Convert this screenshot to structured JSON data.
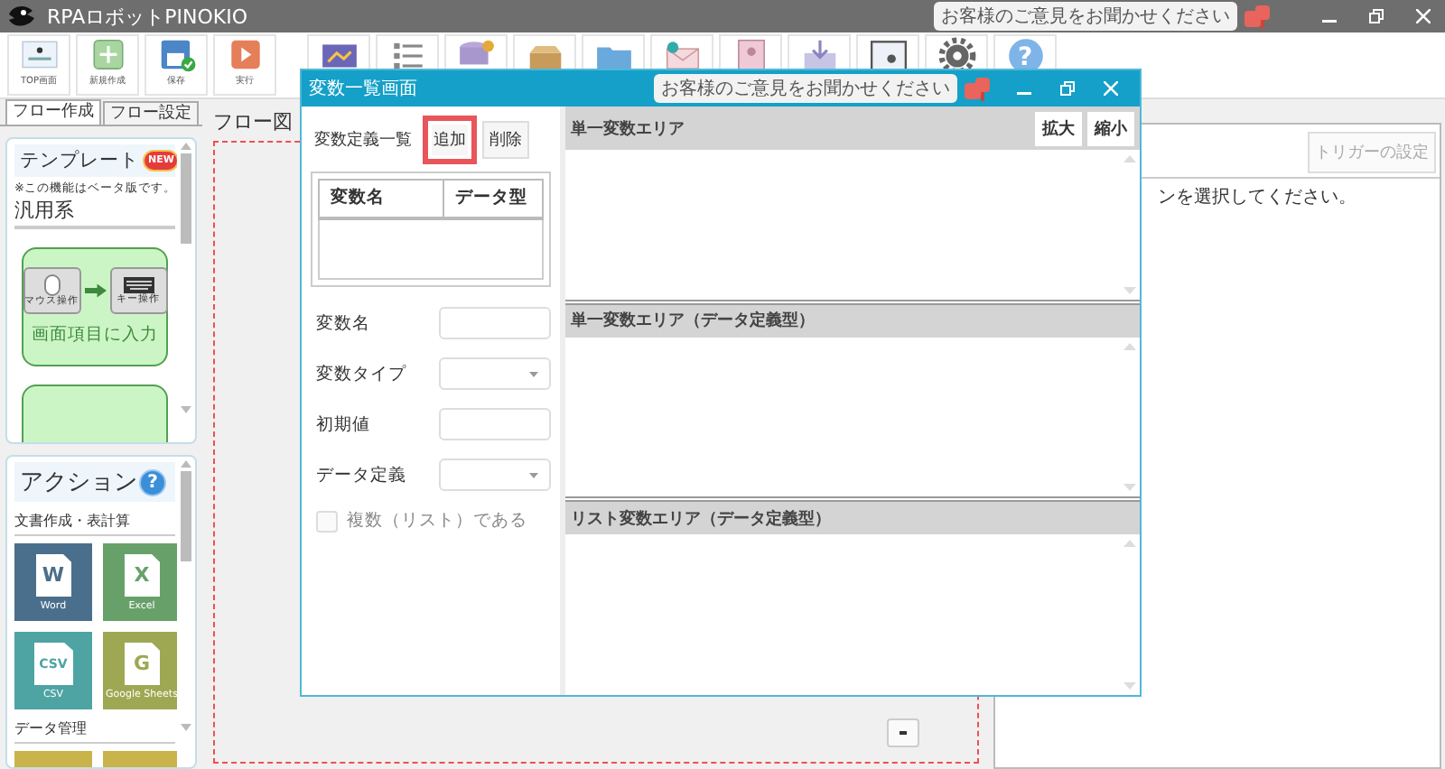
{
  "app": {
    "title": "RPAロボットPINOKIO",
    "feedback": "お客様のご意見をお聞かせください"
  },
  "toolbar": [
    {
      "label": "TOP画面",
      "kind": "top"
    },
    {
      "label": "新規作成",
      "kind": "new"
    },
    {
      "label": "保存",
      "kind": "save"
    },
    {
      "label": "実行",
      "kind": "run"
    },
    {
      "kind": "video"
    },
    {
      "kind": "list"
    },
    {
      "kind": "database"
    },
    {
      "kind": "box"
    },
    {
      "kind": "folder"
    },
    {
      "kind": "mail"
    },
    {
      "kind": "contact"
    },
    {
      "kind": "download"
    },
    {
      "kind": "screen"
    },
    {
      "kind": "settings"
    },
    {
      "kind": "help",
      "glyph": "?"
    }
  ],
  "tabs": [
    {
      "label": "フロー作成",
      "selected": true
    },
    {
      "label": "フロー設定",
      "selected": false
    }
  ],
  "template_panel": {
    "title": "テンプレート",
    "badge": "NEW",
    "note": "※この機能はベータ版です。",
    "category": "汎用系",
    "cards": [
      {
        "label": "画面項目に入力",
        "from": "マウス操作",
        "to": "キー操作"
      }
    ]
  },
  "action_panel": {
    "title": "アクション",
    "help": "?",
    "groups": [
      {
        "title": "文書作成・表計算",
        "tiles": [
          {
            "label": "Word",
            "letter": "W",
            "color": "#4a6f8c"
          },
          {
            "label": "Excel",
            "letter": "X",
            "color": "#67a169"
          },
          {
            "label": "CSV",
            "letter": "CSV",
            "color": "#4ea3a3"
          },
          {
            "label": "Google Sheets",
            "letter": "G",
            "color": "#9ea852"
          }
        ]
      },
      {
        "title": "データ管理",
        "tiles": [
          {
            "color": "#c8b44a"
          },
          {
            "color": "#c8b44a"
          }
        ]
      }
    ]
  },
  "flow": {
    "title": "フロー図"
  },
  "right_panel": {
    "trigger_button": {
      "label": "トリガーの設定",
      "disabled": true
    },
    "message": "ンを選択してください。"
  },
  "dialog": {
    "title": "変数一覧画面",
    "feedback": "お客様のご意見をお聞かせください",
    "list_label": "変数定義一覧",
    "add_button": {
      "label": "追加",
      "highlighted": true
    },
    "delete_button": "削除",
    "table": {
      "columns": [
        "変数名",
        "データ型"
      ]
    },
    "fields": [
      {
        "label": "変数名",
        "kind": "text"
      },
      {
        "label": "変数タイプ",
        "kind": "select"
      },
      {
        "label": "初期値",
        "kind": "text"
      },
      {
        "label": "データ定義",
        "kind": "select"
      }
    ],
    "list_checkbox": {
      "label": "複数（リスト）である",
      "checked": false,
      "disabled": true
    },
    "areas": [
      {
        "title": "単一変数エリア",
        "buttons": [
          "拡大",
          "縮小"
        ]
      },
      {
        "title": "単一変数エリア（データ定義型）"
      },
      {
        "title": "リスト変数エリア（データ定義型）"
      }
    ]
  }
}
